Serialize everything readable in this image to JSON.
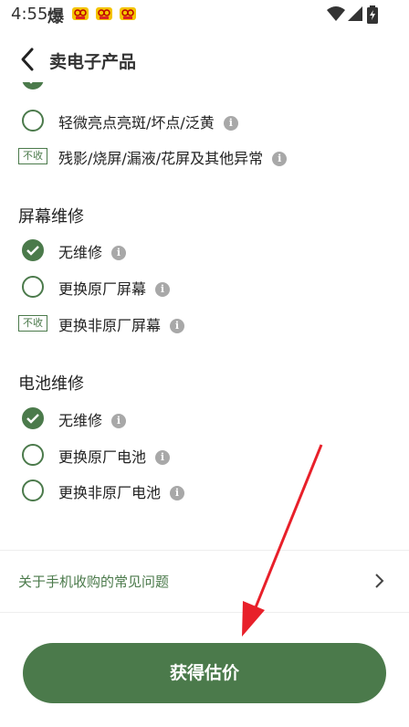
{
  "status_bar": {
    "time": "4:55",
    "glyph": "爆",
    "icons": [
      "wifi-icon",
      "signal-icon",
      "battery-icon"
    ]
  },
  "header": {
    "title": "卖电子产品",
    "back_icon": "chevron-left-icon"
  },
  "group_display_issue": {
    "options": [
      {
        "label": "轻微亮点亮斑/坏点/泛黄",
        "state": "unchecked"
      },
      {
        "label": "残影/烧屏/漏液/花屏及其他异常",
        "state": "not-accepted",
        "tag": "不收"
      }
    ]
  },
  "group_screen_repair": {
    "title": "屏幕维修",
    "options": [
      {
        "label": "无维修",
        "state": "checked"
      },
      {
        "label": "更换原厂屏幕",
        "state": "unchecked"
      },
      {
        "label": "更换非原厂屏幕",
        "state": "not-accepted",
        "tag": "不收"
      }
    ]
  },
  "group_battery_repair": {
    "title": "电池维修",
    "options": [
      {
        "label": "无维修",
        "state": "checked"
      },
      {
        "label": "更换原厂电池",
        "state": "unchecked"
      },
      {
        "label": "更换非原厂电池",
        "state": "unchecked"
      }
    ]
  },
  "faq": {
    "label": "关于手机收购的常见问题"
  },
  "cta": {
    "label": "获得估价"
  },
  "colors": {
    "accent": "#4b7a4b",
    "annotation_arrow": "#e8202a"
  }
}
